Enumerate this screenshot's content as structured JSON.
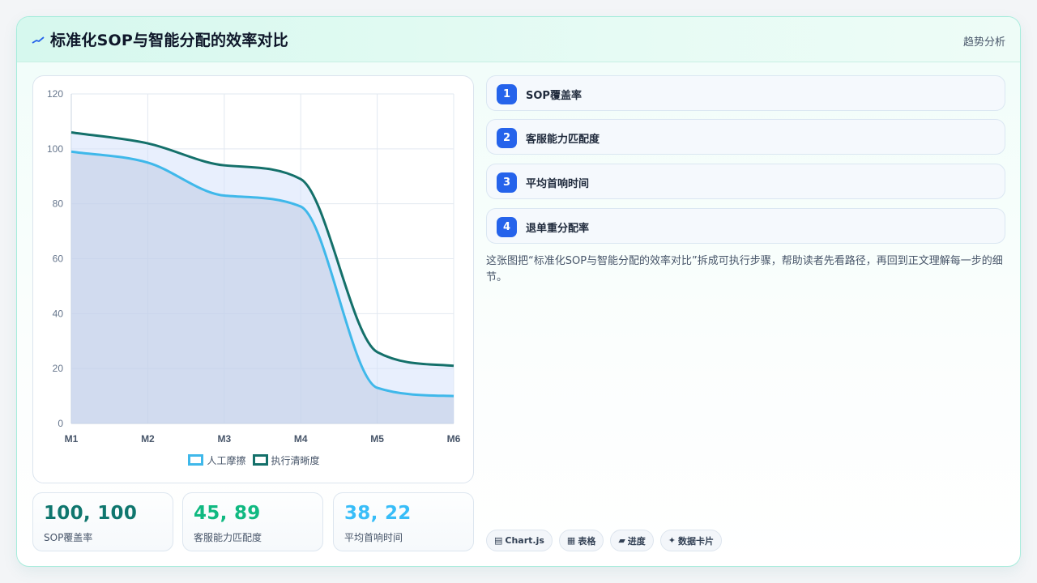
{
  "header": {
    "title": "标准化SOP与智能分配的效率对比",
    "tag": "趋势分析"
  },
  "chart_data": {
    "type": "line",
    "categories": [
      "M1",
      "M2",
      "M3",
      "M4",
      "M5",
      "M6"
    ],
    "series": [
      {
        "name": "人工摩擦",
        "values": [
          99,
          95,
          83,
          79,
          13,
          10
        ],
        "color": "#3fb8ea",
        "fill": "rgba(186, 200, 225, 0.5)"
      },
      {
        "name": "执行清晰度",
        "values": [
          106,
          102,
          94,
          89,
          26,
          21
        ],
        "color": "#14706a",
        "fill": "rgba(214, 226, 252, 0.55)"
      }
    ],
    "ylim": [
      0,
      120
    ],
    "yticks": [
      0,
      20,
      40,
      60,
      80,
      100,
      120
    ],
    "grid": true,
    "legend_position": "bottom"
  },
  "kpis": [
    {
      "value": "100, 100",
      "label": "SOP覆盖率",
      "color": "#0f766e"
    },
    {
      "value": "45, 89",
      "label": "客服能力匹配度",
      "color": "#10b981"
    },
    {
      "value": "38, 22",
      "label": "平均首响时间",
      "color": "#38bdf8"
    }
  ],
  "steps": [
    {
      "num": "1",
      "label": "SOP覆盖率"
    },
    {
      "num": "2",
      "label": "客服能力匹配度"
    },
    {
      "num": "3",
      "label": "平均首响时间"
    },
    {
      "num": "4",
      "label": "退单重分配率"
    }
  ],
  "description": "这张图把“标准化SOP与智能分配的效率对比”拆成可执行步骤，帮助读者先看路径，再回到正文理解每一步的细节。",
  "pills": [
    {
      "icon": "▤",
      "label": "Chart.js"
    },
    {
      "icon": "▦",
      "label": "表格"
    },
    {
      "icon": "▰",
      "label": "进度"
    },
    {
      "icon": "✦",
      "label": "数据卡片"
    }
  ]
}
